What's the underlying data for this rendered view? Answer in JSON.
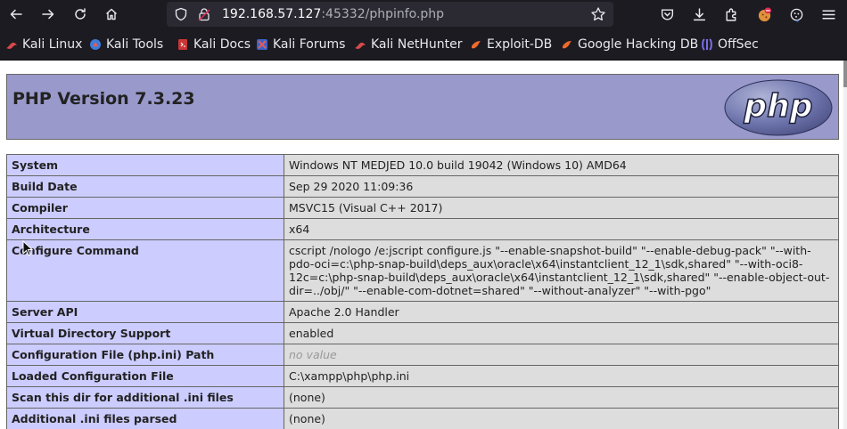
{
  "browser": {
    "url_host": "192.168.57.127",
    "url_path": ":45332/phpinfo.php",
    "bookmarks": [
      {
        "label": "Kali Linux",
        "icon": "kali-dragon-icon"
      },
      {
        "label": "Kali Tools",
        "icon": "kali-tools-icon"
      },
      {
        "label": "Kali Docs",
        "icon": "kali-docs-icon"
      },
      {
        "label": "Kali Forums",
        "icon": "kali-forums-icon"
      },
      {
        "label": "Kali NetHunter",
        "icon": "kali-nethunter-icon"
      },
      {
        "label": "Exploit-DB",
        "icon": "exploit-db-icon"
      },
      {
        "label": "Google Hacking DB",
        "icon": "ghdb-icon"
      },
      {
        "label": "OffSec",
        "icon": "offsec-icon"
      }
    ]
  },
  "phpinfo": {
    "title": "PHP Version 7.3.23",
    "logo_text": "php",
    "rows": [
      {
        "key": "System",
        "value": "Windows NT MEDJED 10.0 build 19042 (Windows 10) AMD64"
      },
      {
        "key": "Build Date",
        "value": "Sep 29 2020 11:09:36"
      },
      {
        "key": "Compiler",
        "value": "MSVC15 (Visual C++ 2017)"
      },
      {
        "key": "Architecture",
        "value": "x64"
      },
      {
        "key": "Configure Command",
        "value": "cscript /nologo /e:jscript configure.js \"--enable-snapshot-build\" \"--enable-debug-pack\" \"--with-pdo-oci=c:\\php-snap-build\\deps_aux\\oracle\\x64\\instantclient_12_1\\sdk,shared\" \"--with-oci8-12c=c:\\php-snap-build\\deps_aux\\oracle\\x64\\instantclient_12_1\\sdk,shared\" \"--enable-object-out-dir=../obj/\" \"--enable-com-dotnet=shared\" \"--without-analyzer\" \"--with-pgo\""
      },
      {
        "key": "Server API",
        "value": "Apache 2.0 Handler"
      },
      {
        "key": "Virtual Directory Support",
        "value": "enabled"
      },
      {
        "key": "Configuration File (php.ini) Path",
        "value": "no value"
      },
      {
        "key": "Loaded Configuration File",
        "value": "C:\\xampp\\php\\php.ini"
      },
      {
        "key": "Scan this dir for additional .ini files",
        "value": "(none)"
      },
      {
        "key": "Additional .ini files parsed",
        "value": "(none)"
      }
    ]
  },
  "colors": {
    "header_bg": "#9999cc",
    "key_bg": "#ccccff",
    "value_bg": "#dddddd",
    "chrome_bg": "#1c1b22"
  }
}
